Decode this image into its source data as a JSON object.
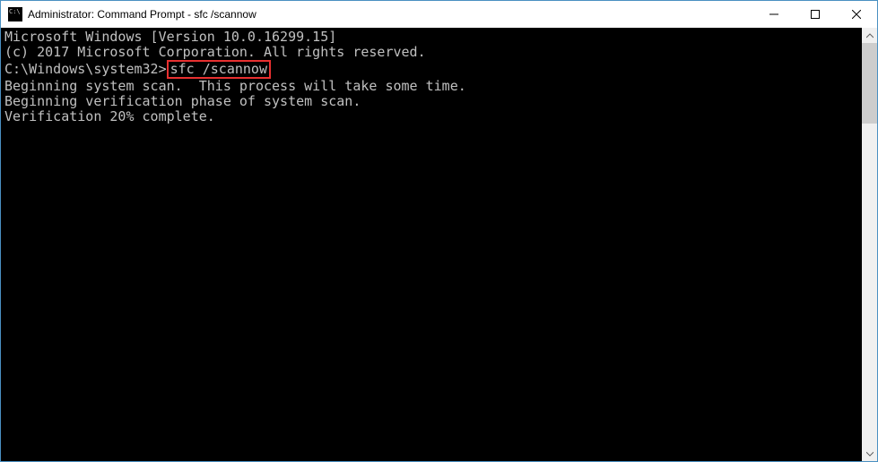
{
  "window": {
    "title": "Administrator: Command Prompt - sfc  /scannow"
  },
  "terminal": {
    "line1": "Microsoft Windows [Version 10.0.16299.15]",
    "line2": "(c) 2017 Microsoft Corporation. All rights reserved.",
    "blank1": "",
    "prompt_prefix": "C:\\Windows\\system32>",
    "command": "sfc /scannow",
    "blank2": "",
    "line3": "Beginning system scan.  This process will take some time.",
    "blank3": "",
    "line4": "Beginning verification phase of system scan.",
    "line5": "Verification 20% complete."
  }
}
